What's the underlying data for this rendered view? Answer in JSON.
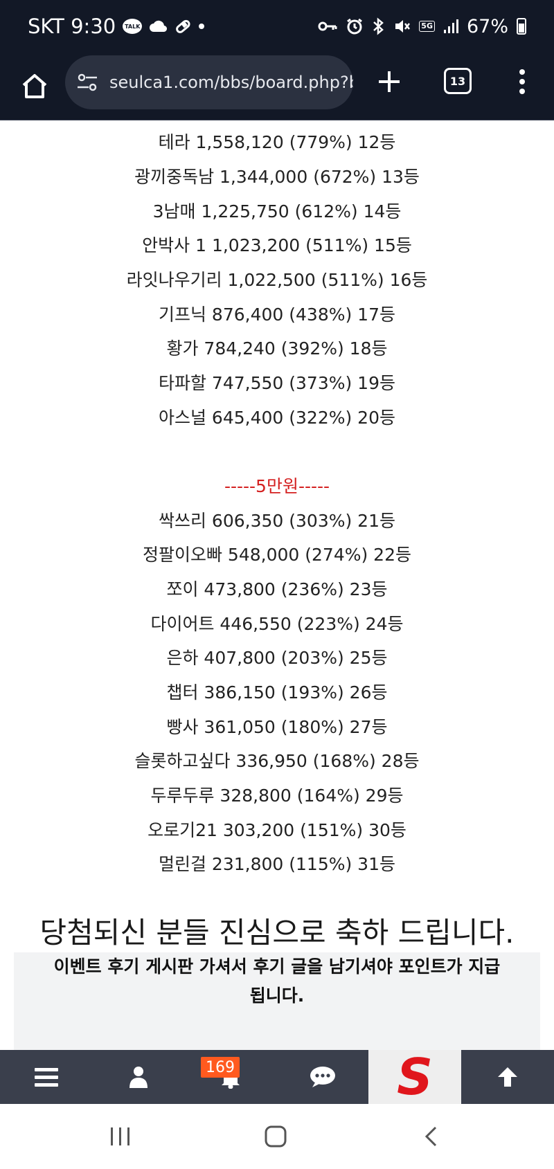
{
  "status_bar": {
    "carrier_time": "SKT 9:30",
    "talk_label": "TALK",
    "net_label": "5G",
    "battery_text": "67%",
    "icons": [
      "talk-icon",
      "cloud-icon",
      "pill-icon",
      "dot-icon",
      "key-icon",
      "alarm-icon",
      "bluetooth-icon",
      "mute-icon",
      "5g-icon",
      "signal-icon",
      "battery-icon"
    ]
  },
  "browser": {
    "url": "seulca1.com/bbs/board.php?bo",
    "tab_count": "13"
  },
  "rankings_top": [
    "테라 1,558,120 (779%) 12등",
    "광끼중독남 1,344,000 (672%) 13등",
    "3남매 1,225,750 (612%) 14등",
    "안박사 1 1,023,200 (511%) 15등",
    "라잇나우기리 1,022,500 (511%) 16등",
    "기프닉 876,400 (438%) 17등",
    "황가 784,240 (392%) 18등",
    "타파할 747,550 (373%) 19등",
    "아스널 645,400 (322%) 20등"
  ],
  "tier_divider": "-----5만원-----",
  "rankings_bottom": [
    "싹쓰리 606,350 (303%) 21등",
    "정팔이오빠 548,000 (274%) 22등",
    "쪼이 473,800 (236%) 23등",
    "다이어트 446,550 (223%) 24등",
    "은하 407,800 (203%) 25등",
    "챕터 386,150 (193%) 26등",
    "빵사 361,050 (180%) 27등",
    "슬롯하고싶다 336,950 (168%) 28등",
    "두루두루 328,800 (164%) 29등",
    "오로기21 303,200 (151%) 30등",
    "멀린걸 231,800 (115%) 31등"
  ],
  "congrats": "당첨되신 분들 진심으로 축하 드립니다.",
  "notice": {
    "line1": "이벤트 후기 게시판 가셔서 후기 글을 남기셔야 포인트가 지급",
    "line2": "됩니다."
  },
  "site_nav": {
    "notification_count": "169",
    "logo_letter": "S"
  },
  "colors": {
    "status_bg": "#121826",
    "url_pill": "#2b3140",
    "divider_red": "#d42020",
    "nav_bg": "#3a3f4c",
    "badge_orange": "#ff5a1f",
    "logo_red": "#e0161c"
  }
}
